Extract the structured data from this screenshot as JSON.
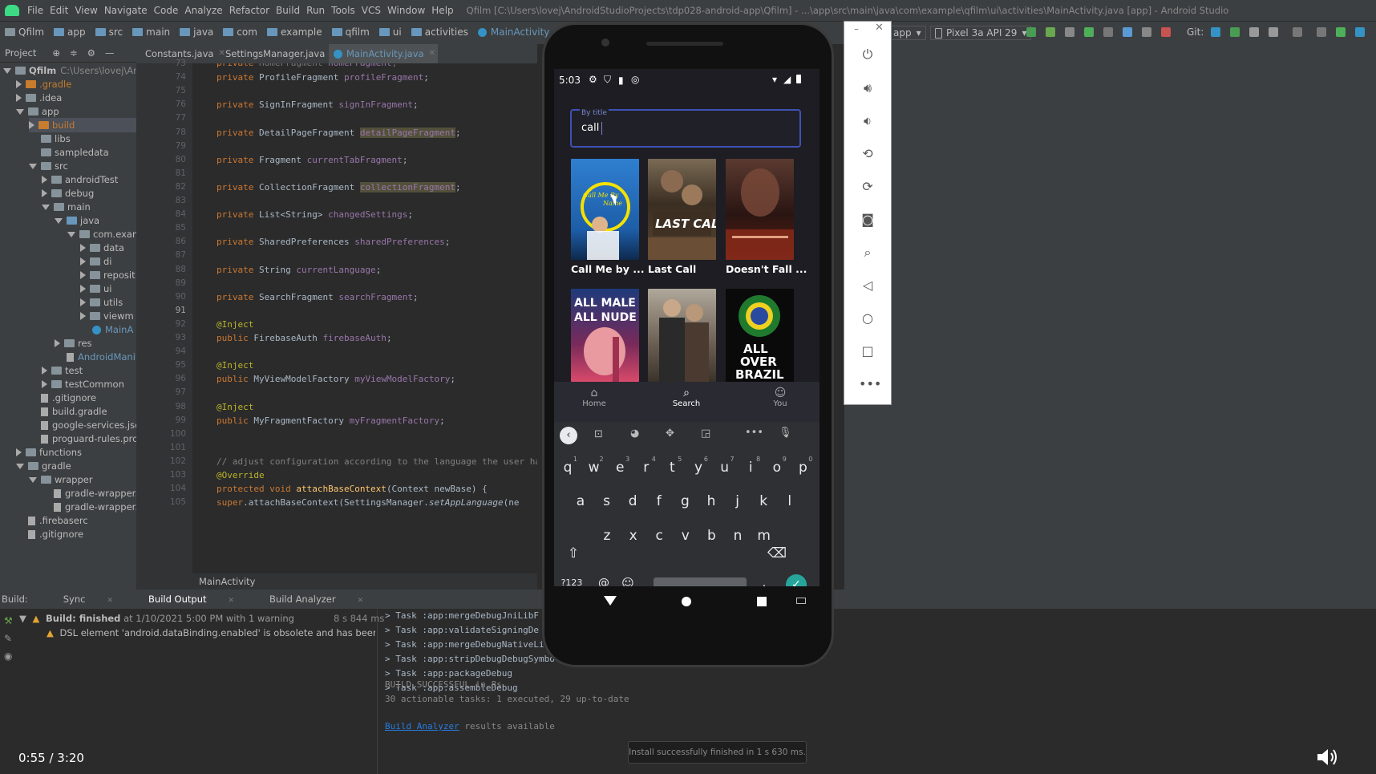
{
  "ide": {
    "menu": [
      "File",
      "Edit",
      "View",
      "Navigate",
      "Code",
      "Analyze",
      "Refactor",
      "Build",
      "Run",
      "Tools",
      "VCS",
      "Window",
      "Help"
    ],
    "window_title": "Qfilm [C:\\Users\\lovej\\AndroidStudioProjects\\tdp028-android-app\\Qfilm] - ...\\app\\src\\main\\java\\com\\example\\qfilm\\ui\\activities\\MainActivity.java [app] - Android Studio",
    "breadcrumbs": [
      "Qfilm",
      "app",
      "src",
      "main",
      "java",
      "com",
      "example",
      "qfilm",
      "ui",
      "activities",
      "MainActivity"
    ],
    "device_selector": "Pixel 3a API 29",
    "run_config": "app",
    "git_label": "Git:",
    "project_panel_label": "Project",
    "editor_tabs": [
      {
        "label": "Constants.java",
        "active": false
      },
      {
        "label": "SettingsManager.java",
        "active": false
      },
      {
        "label": "MainActivity.java",
        "active": true
      }
    ],
    "tree": [
      {
        "label": "Qfilm",
        "extra": "C:\\Users\\lovej\\AndroidS",
        "indent": 0,
        "open": true,
        "kind": "folder"
      },
      {
        "label": ".gradle",
        "indent": 1,
        "open": false,
        "kind": "orange"
      },
      {
        "label": ".idea",
        "indent": 1,
        "open": false,
        "kind": "folder"
      },
      {
        "label": "app",
        "indent": 1,
        "open": true,
        "kind": "folder"
      },
      {
        "label": "build",
        "indent": 2,
        "open": false,
        "kind": "orange"
      },
      {
        "label": "libs",
        "indent": 2,
        "open": null,
        "kind": "folder"
      },
      {
        "label": "sampledata",
        "indent": 2,
        "open": null,
        "kind": "folder"
      },
      {
        "label": "src",
        "indent": 2,
        "open": true,
        "kind": "folder"
      },
      {
        "label": "androidTest",
        "indent": 3,
        "open": false,
        "kind": "folder"
      },
      {
        "label": "debug",
        "indent": 3,
        "open": false,
        "kind": "folder"
      },
      {
        "label": "main",
        "indent": 3,
        "open": true,
        "kind": "folder"
      },
      {
        "label": "java",
        "indent": 4,
        "open": true,
        "kind": "blue"
      },
      {
        "label": "com.exam",
        "indent": 5,
        "open": true,
        "kind": "folder"
      },
      {
        "label": "data",
        "indent": 6,
        "open": false,
        "kind": "folder"
      },
      {
        "label": "di",
        "indent": 6,
        "open": false,
        "kind": "folder"
      },
      {
        "label": "reposit",
        "indent": 6,
        "open": false,
        "kind": "folder"
      },
      {
        "label": "ui",
        "indent": 6,
        "open": false,
        "kind": "folder"
      },
      {
        "label": "utils",
        "indent": 6,
        "open": false,
        "kind": "folder"
      },
      {
        "label": "viewm",
        "indent": 6,
        "open": false,
        "kind": "folder"
      },
      {
        "label": "MainA",
        "indent": 6,
        "open": null,
        "kind": "class"
      },
      {
        "label": "res",
        "indent": 4,
        "open": false,
        "kind": "folder"
      },
      {
        "label": "AndroidManif",
        "indent": 4,
        "open": null,
        "kind": "file"
      },
      {
        "label": "test",
        "indent": 3,
        "open": false,
        "kind": "folder"
      },
      {
        "label": "testCommon",
        "indent": 3,
        "open": false,
        "kind": "folder"
      },
      {
        "label": ".gitignore",
        "indent": 2,
        "open": null,
        "kind": "file"
      },
      {
        "label": "build.gradle",
        "indent": 2,
        "open": null,
        "kind": "file"
      },
      {
        "label": "google-services.json",
        "indent": 2,
        "open": null,
        "kind": "file"
      },
      {
        "label": "proguard-rules.pro",
        "indent": 2,
        "open": null,
        "kind": "file"
      },
      {
        "label": "functions",
        "indent": 1,
        "open": false,
        "kind": "folder"
      },
      {
        "label": "gradle",
        "indent": 1,
        "open": true,
        "kind": "folder"
      },
      {
        "label": "wrapper",
        "indent": 2,
        "open": true,
        "kind": "folder"
      },
      {
        "label": "gradle-wrapper.ja",
        "indent": 3,
        "open": null,
        "kind": "file"
      },
      {
        "label": "gradle-wrapper.p",
        "indent": 3,
        "open": null,
        "kind": "file"
      },
      {
        "label": ".firebaserc",
        "indent": 1,
        "open": null,
        "kind": "file"
      },
      {
        "label": ".gitignore",
        "indent": 1,
        "open": null,
        "kind": "file"
      }
    ],
    "line_numbers": [
      73,
      74,
      75,
      76,
      77,
      78,
      79,
      80,
      81,
      82,
      83,
      84,
      85,
      86,
      87,
      88,
      89,
      90,
      91,
      92,
      93,
      94,
      95,
      96,
      97,
      98,
      99,
      100,
      101,
      102,
      103,
      104,
      105
    ],
    "code_lines": [
      {
        "n": 74,
        "tokens": [
          [
            "kw",
            "private "
          ],
          [
            "",
            "ProfileFragment "
          ],
          [
            "fld",
            "profileFragment"
          ],
          [
            "",
            ";"
          ]
        ]
      },
      {
        "n": 76,
        "tokens": [
          [
            "kw",
            "private "
          ],
          [
            "",
            "SignInFragment "
          ],
          [
            "fld",
            "signInFragment"
          ],
          [
            "",
            ";"
          ]
        ]
      },
      {
        "n": 78,
        "tokens": [
          [
            "kw",
            "private "
          ],
          [
            "",
            "DetailPageFragment "
          ],
          [
            "fld hl",
            "detailPageFragment"
          ],
          [
            "",
            ";"
          ]
        ]
      },
      {
        "n": 80,
        "tokens": [
          [
            "kw",
            "private "
          ],
          [
            "",
            "Fragment "
          ],
          [
            "fld",
            "currentTabFragment"
          ],
          [
            "",
            ";"
          ]
        ]
      },
      {
        "n": 82,
        "tokens": [
          [
            "kw",
            "private "
          ],
          [
            "",
            "CollectionFragment "
          ],
          [
            "fld hl",
            "collectionFragment"
          ],
          [
            "",
            ";"
          ]
        ]
      },
      {
        "n": 84,
        "tokens": [
          [
            "kw",
            "private "
          ],
          [
            "",
            "List<String> "
          ],
          [
            "fld",
            "changedSettings"
          ],
          [
            "",
            ";"
          ]
        ]
      },
      {
        "n": 86,
        "tokens": [
          [
            "kw",
            "private "
          ],
          [
            "",
            "SharedPreferences "
          ],
          [
            "fld",
            "sharedPreferences"
          ],
          [
            "",
            ";"
          ]
        ]
      },
      {
        "n": 88,
        "tokens": [
          [
            "kw",
            "private "
          ],
          [
            "",
            "String "
          ],
          [
            "fld",
            "currentLanguage"
          ],
          [
            "",
            ";"
          ]
        ]
      },
      {
        "n": 90,
        "tokens": [
          [
            "kw",
            "private "
          ],
          [
            "",
            "SearchFragment "
          ],
          [
            "fld",
            "searchFragment"
          ],
          [
            "",
            ";"
          ]
        ]
      },
      {
        "n": 92,
        "tokens": [
          [
            "ann",
            "@Inject"
          ]
        ]
      },
      {
        "n": 93,
        "tokens": [
          [
            "kw",
            "public "
          ],
          [
            "",
            "FirebaseAuth "
          ],
          [
            "fld",
            "firebaseAuth"
          ],
          [
            "",
            ";"
          ]
        ]
      },
      {
        "n": 95,
        "tokens": [
          [
            "ann",
            "@Inject"
          ]
        ]
      },
      {
        "n": 96,
        "tokens": [
          [
            "kw",
            "public "
          ],
          [
            "",
            "MyViewModelFactory "
          ],
          [
            "fld",
            "myViewModelFactory"
          ],
          [
            "",
            ";"
          ]
        ]
      },
      {
        "n": 98,
        "tokens": [
          [
            "ann",
            "@Inject"
          ]
        ]
      },
      {
        "n": 99,
        "tokens": [
          [
            "kw",
            "public  "
          ],
          [
            "",
            "MyFragmentFactory "
          ],
          [
            "fld",
            "myFragmentFactory"
          ],
          [
            "",
            ";"
          ]
        ]
      },
      {
        "n": 102,
        "tokens": [
          [
            "cmt",
            "// adjust configuration according to the language the user ha"
          ]
        ]
      },
      {
        "n": 103,
        "tokens": [
          [
            "ann",
            "@Override"
          ]
        ]
      },
      {
        "n": 104,
        "tokens": [
          [
            "kw",
            "protected void "
          ],
          [
            "mth",
            "attachBaseContext"
          ],
          [
            "",
            "(Context newBase) {"
          ]
        ]
      },
      {
        "n": 105,
        "tokens": [
          [
            "kw",
            "    super"
          ],
          [
            "",
            ".attachBaseContext(SettingsManager."
          ],
          [
            "it",
            "setAppLanguage"
          ],
          [
            "",
            "(ne"
          ]
        ]
      }
    ],
    "first_line_partial": "private HomeFragment homeFragment;",
    "editor_footer": "MainActivity",
    "build_tabs": [
      "Build:",
      "Sync",
      "Build Output",
      "Build Analyzer"
    ],
    "build_status_bold": "Build: finished",
    "build_status_rest": "at 1/10/2021 5:00 PM with 1 warning",
    "build_time": "8 s 844 ms",
    "build_warning": "DSL element 'android.dataBinding.enabled' is obsolete and has been replaced w",
    "tasks": [
      "> Task :app:mergeDebugJniLibF",
      "> Task :app:validateSigningDe",
      "> Task :app:mergeDebugNativeLi",
      "> Task :app:stripDebugDebugSymbo",
      "> Task :app:packageDebug",
      "> Task :app:assembleDebug"
    ],
    "build_success": "BUILD SUCCESSFUL in 8s",
    "actionable": "30 actionable tasks: 1 executed, 29 up-to-date",
    "analyzer_link": "Build Analyzer",
    "analyzer_rest": " results available",
    "toast": "Install successfully finished in 1 s 630 ms."
  },
  "phone": {
    "status_time": "5:03",
    "search_label": "By title",
    "search_value": "call",
    "movies": [
      {
        "title": "Call Me by ...",
        "colors": [
          "#2a6fb5",
          "#f5d800"
        ]
      },
      {
        "title": "Last Call",
        "colors": [
          "#4a3a2a",
          "#b08a5a"
        ]
      },
      {
        "title": "Doesn't Fall ...",
        "colors": [
          "#3b1a18",
          "#8a3a2a"
        ]
      },
      {
        "title": "",
        "colors": [
          "#1a2a5a",
          "#e84a6a"
        ]
      },
      {
        "title": "",
        "colors": [
          "#2a2a2a",
          "#7a6a5a"
        ]
      },
      {
        "title": "",
        "colors": [
          "#0a0a0a",
          "#2a8a3a"
        ]
      }
    ],
    "poster_text": {
      "p1": "Call Me By Your Name",
      "p2": "LAST CALL",
      "p4": "ALL MALE ALL NUDE",
      "p6": "ALL OVER BRAZIL"
    },
    "nav": [
      {
        "label": "Home",
        "icon": "home-icon",
        "active": false
      },
      {
        "label": "Search",
        "icon": "search-icon",
        "active": true
      },
      {
        "label": "You",
        "icon": "person-icon",
        "active": false
      }
    ],
    "keyboard": {
      "row1": [
        "q",
        "w",
        "e",
        "r",
        "t",
        "y",
        "u",
        "i",
        "o",
        "p"
      ],
      "row1_hints": [
        "1",
        "2",
        "3",
        "4",
        "5",
        "6",
        "7",
        "8",
        "9",
        "0"
      ],
      "row2": [
        "a",
        "s",
        "d",
        "f",
        "g",
        "h",
        "j",
        "k",
        "l"
      ],
      "row3": [
        "z",
        "x",
        "c",
        "v",
        "b",
        "n",
        "m"
      ],
      "symbols": "?123",
      "at": "@",
      "period": "."
    }
  },
  "video": {
    "timecode": "0:55 / 3:20"
  },
  "colors": {
    "accent": "#3f51b5",
    "android_green": "#3ddc84",
    "confirm": "#26a69a"
  }
}
